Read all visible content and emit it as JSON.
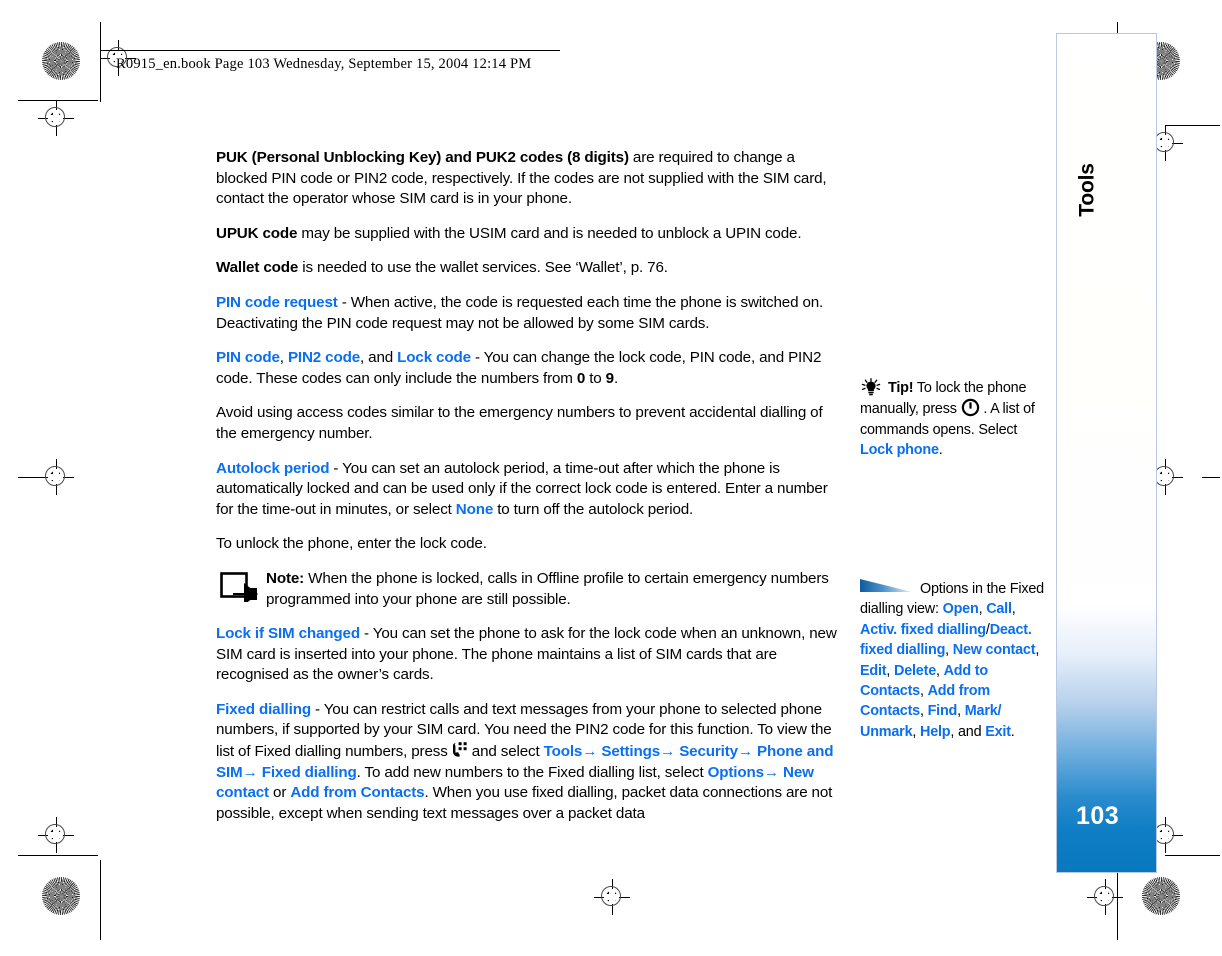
{
  "header": {
    "line": "R0915_en.book  Page 103  Wednesday, September 15, 2004  12:14 PM"
  },
  "side_tab": {
    "label": "Tools",
    "page_number": "103"
  },
  "icons": {
    "note": "note-arrow-icon",
    "tip": "lightbulb-icon",
    "power": "power-key-icon",
    "menu": "menu-key-icon",
    "options": "options-triangle-icon"
  },
  "colors": {
    "link_blue": "#0a6ff0",
    "tab_blue": "#0878bf",
    "text_black": "#000000"
  },
  "body": {
    "paragraphs": [
      {
        "id": "puk",
        "runs": [
          {
            "style": "bold",
            "text": "PUK (Personal Unblocking Key) and PUK2 codes (8 digits)"
          },
          {
            "style": "normal",
            "text": " are required to change a blocked PIN code or PIN2 code, respectively. If the codes are not supplied with the SIM card, contact the operator whose SIM card is in your phone."
          }
        ]
      },
      {
        "id": "upuk",
        "runs": [
          {
            "style": "bold",
            "text": "UPUK code"
          },
          {
            "style": "normal",
            "text": " may be supplied with the USIM card and is needed to unblock a UPIN code."
          }
        ]
      },
      {
        "id": "wallet",
        "runs": [
          {
            "style": "bold",
            "text": "Wallet code"
          },
          {
            "style": "normal",
            "text": " is needed to use the wallet services. See ‘Wallet’, p. 76."
          }
        ]
      },
      {
        "id": "pin-code-request",
        "runs": [
          {
            "style": "blue",
            "text": "PIN code request"
          },
          {
            "style": "normal",
            "text": " - When active, the code is requested each time the phone is switched on. Deactivating the PIN code request may not be allowed by some SIM cards."
          }
        ]
      },
      {
        "id": "pin-pin2-lock",
        "runs": [
          {
            "style": "blue",
            "text": "PIN code"
          },
          {
            "style": "normal",
            "text": ", "
          },
          {
            "style": "blue",
            "text": "PIN2 code"
          },
          {
            "style": "normal",
            "text": ", and "
          },
          {
            "style": "blue",
            "text": "Lock code"
          },
          {
            "style": "normal",
            "text": " - You can change the lock code, PIN code, and PIN2 code. These codes can only include the numbers from "
          },
          {
            "style": "bold",
            "text": "0"
          },
          {
            "style": "normal",
            "text": " to "
          },
          {
            "style": "bold",
            "text": "9"
          },
          {
            "style": "normal",
            "text": "."
          }
        ]
      },
      {
        "id": "avoid-access-codes",
        "runs": [
          {
            "style": "normal",
            "text": "Avoid using access codes similar to the emergency numbers to prevent accidental dialling of the emergency number."
          }
        ]
      },
      {
        "id": "autolock-period",
        "runs": [
          {
            "style": "blue",
            "text": "Autolock period"
          },
          {
            "style": "normal",
            "text": " - You can set an autolock period, a time-out after which the phone is automatically locked and can be used only if the correct lock code is entered. Enter a number for the time-out in minutes, or select "
          },
          {
            "style": "blue",
            "text": "None"
          },
          {
            "style": "normal",
            "text": " to turn off the autolock period."
          }
        ]
      },
      {
        "id": "unlock-phone",
        "runs": [
          {
            "style": "normal",
            "text": "To unlock the phone, enter the lock code."
          }
        ]
      }
    ],
    "note": {
      "label": "Note:",
      "text": " When the phone is locked, calls in Offline profile to certain emergency numbers programmed into your phone are still possible."
    },
    "paragraphs_after_note": [
      {
        "id": "lock-if-sim-changed",
        "runs": [
          {
            "style": "blue",
            "text": "Lock if SIM changed"
          },
          {
            "style": "normal",
            "text": " - You can set the phone to ask for the lock code when an unknown, new SIM card is inserted into your phone. The phone maintains a list of SIM cards that are recognised as the owner’s cards."
          }
        ]
      }
    ],
    "fixed_dialling": {
      "lead_bold": "Fixed dialling",
      "t1": " - You can restrict calls and text messages from your phone to selected phone numbers, if supported by your SIM card. You need the PIN2 code for this function. To view the list of Fixed dialling numbers, press ",
      "t2": " and select ",
      "m1": "Tools",
      "a1": "→",
      "m2": "Settings",
      "a2": "→",
      "m3": "Security",
      "a3": "→",
      "m4": "Phone and SIM",
      "a4": "→",
      "m5": "Fixed dialling",
      "t3": ". To add new numbers to the Fixed dialling list, select ",
      "m6": "Options",
      "a5": "→",
      "m7": "New contact",
      "t4": " or ",
      "m8": "Add from Contacts",
      "t5": ". When you use fixed dialling, packet data connections are not possible, except when sending text messages over a packet data"
    }
  },
  "margin": {
    "tip": {
      "label": "Tip!",
      "t1": " To lock the phone manually, press ",
      "t2": " . A list of commands opens. Select ",
      "link": "Lock phone",
      "t3": "."
    },
    "options": {
      "t1": "Options in the Fixed dialling view: ",
      "items": [
        {
          "text": "Open",
          "sep": ", "
        },
        {
          "text": "Call",
          "sep": ", "
        },
        {
          "text": "Activ. fixed dialling",
          "sep": "/"
        },
        {
          "text": "Deact. fixed dialling",
          "sep": ", "
        },
        {
          "text": "New contact",
          "sep": ", "
        },
        {
          "text": "Edit",
          "sep": ", "
        },
        {
          "text": "Delete",
          "sep": ", "
        },
        {
          "text": "Add to Contacts",
          "sep": ", "
        },
        {
          "text": "Add from Contacts",
          "sep": ", "
        },
        {
          "text": "Find",
          "sep": ", "
        },
        {
          "text": "Mark/ Unmark",
          "sep": ", "
        },
        {
          "text": "Help",
          "sep": ", and "
        },
        {
          "text": "Exit",
          "sep": "."
        }
      ]
    }
  }
}
